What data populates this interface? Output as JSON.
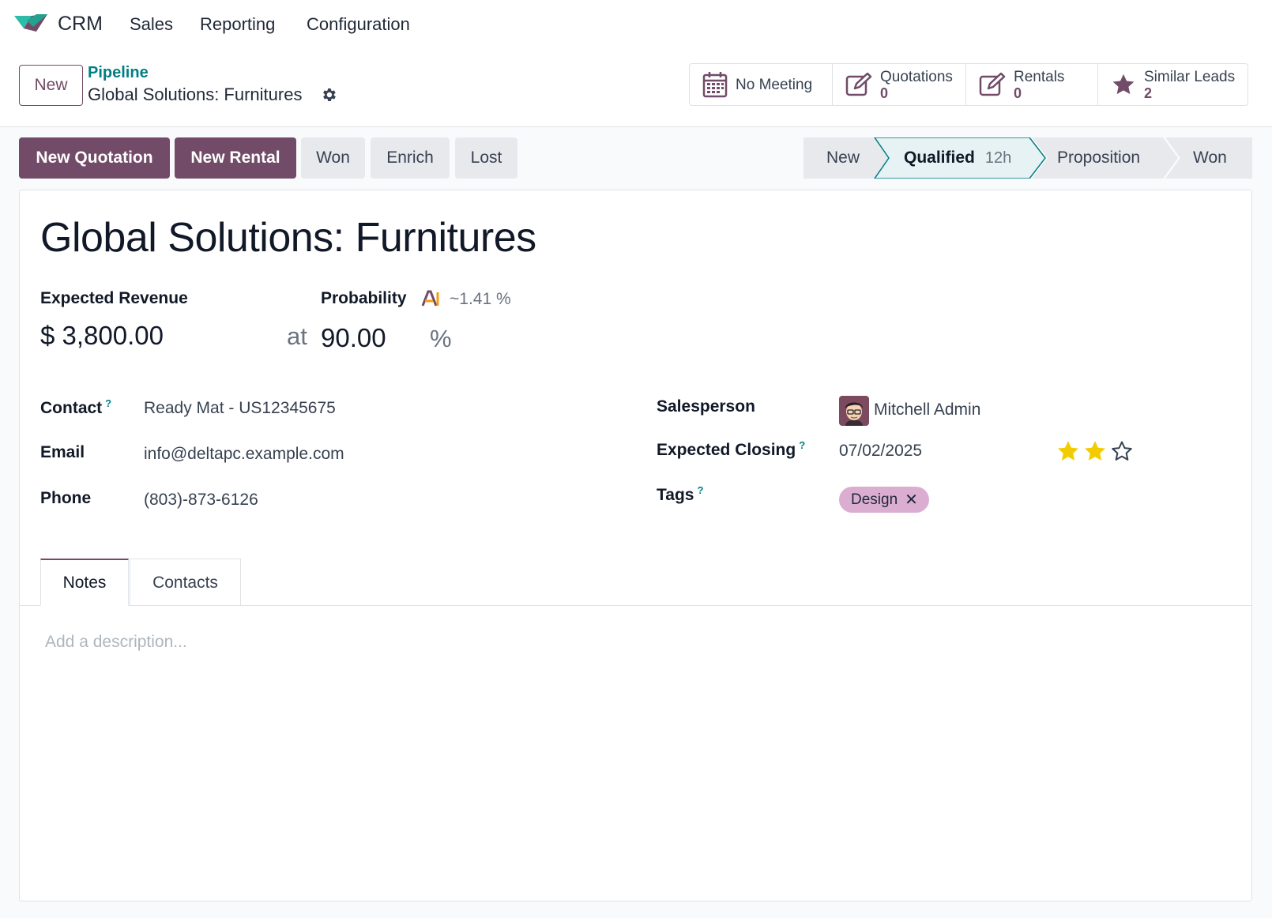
{
  "nav": {
    "app_name": "CRM",
    "menu": [
      "Sales",
      "Reporting",
      "Configuration"
    ]
  },
  "control": {
    "new_label": "New",
    "breadcrumb_parent": "Pipeline",
    "breadcrumb_current": "Global Solutions: Furnitures"
  },
  "smart_buttons": {
    "meeting": "No Meeting",
    "quotations": {
      "label": "Quotations",
      "count": "0"
    },
    "rentals": {
      "label": "Rentals",
      "count": "0"
    },
    "similar": {
      "label": "Similar Leads",
      "count": "2"
    }
  },
  "actions": {
    "new_quotation": "New Quotation",
    "new_rental": "New Rental",
    "won": "Won",
    "enrich": "Enrich",
    "lost": "Lost"
  },
  "stages": {
    "items": [
      "New",
      "Qualified",
      "Proposition",
      "Won"
    ],
    "active": "Qualified",
    "active_duration": "12h"
  },
  "form": {
    "title": "Global Solutions: Furnitures",
    "expected_revenue_label": "Expected Revenue",
    "expected_revenue": "$ 3,800.00",
    "at_label": "at",
    "probability_label": "Probability",
    "probability_ai": "~1.41 %",
    "probability": "90.00",
    "percent_sign": "%",
    "contact_label": "Contact",
    "contact": "Ready Mat - US12345675",
    "email_label": "Email",
    "email": "info@deltapc.example.com",
    "phone_label": "Phone",
    "phone": "(803)-873-6126",
    "salesperson_label": "Salesperson",
    "salesperson": "Mitchell Admin",
    "closing_label": "Expected Closing",
    "closing": "07/02/2025",
    "tags_label": "Tags",
    "tag": "Design",
    "help_mark": "?",
    "priority_stars": 2,
    "priority_max": 3
  },
  "tabs": {
    "notes": "Notes",
    "contacts": "Contacts",
    "description_placeholder": "Add a description..."
  },
  "colors": {
    "brand": "#714b67",
    "link": "#017e84",
    "star": "#f3cc00",
    "tag": "#dbaed1"
  }
}
